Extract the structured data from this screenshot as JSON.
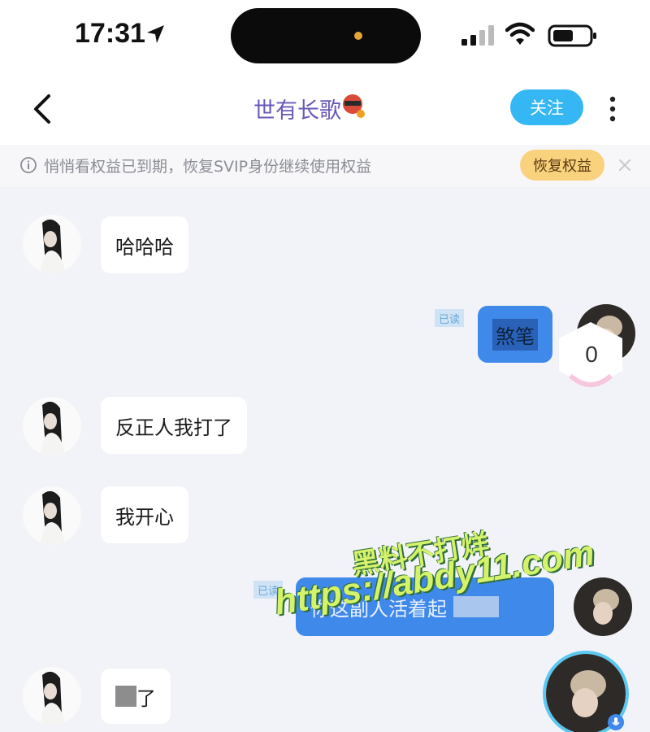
{
  "status_bar": {
    "time": "17:31"
  },
  "header": {
    "back_icon": "chevron-left-icon",
    "title": "世有长歌",
    "follow_label": "关注",
    "more_icon": "vertical-dots-icon"
  },
  "notice": {
    "text": "悄悄看权益已到期，恢复SVIP身份继续使用权益",
    "action_label": "恢复权益"
  },
  "messages": [
    {
      "side": "left",
      "text": "哈哈哈"
    },
    {
      "side": "right",
      "read": "已读",
      "text": "煞笔"
    },
    {
      "side": "left",
      "text": "反正人我打了"
    },
    {
      "side": "left",
      "text": "我开心"
    },
    {
      "side": "right",
      "read": "已读",
      "text": "你这副人活着起"
    },
    {
      "side": "left",
      "text": "了"
    }
  ],
  "like_badge": {
    "count": "0"
  },
  "watermark": {
    "line1": "黑料不打烊",
    "line2": "https://abdy11.com"
  },
  "colors": {
    "accent": "#35b7f4",
    "outgoing_bubble": "#3f89ea",
    "title": "#6a58b8",
    "restore_button": "#f9d27e"
  }
}
